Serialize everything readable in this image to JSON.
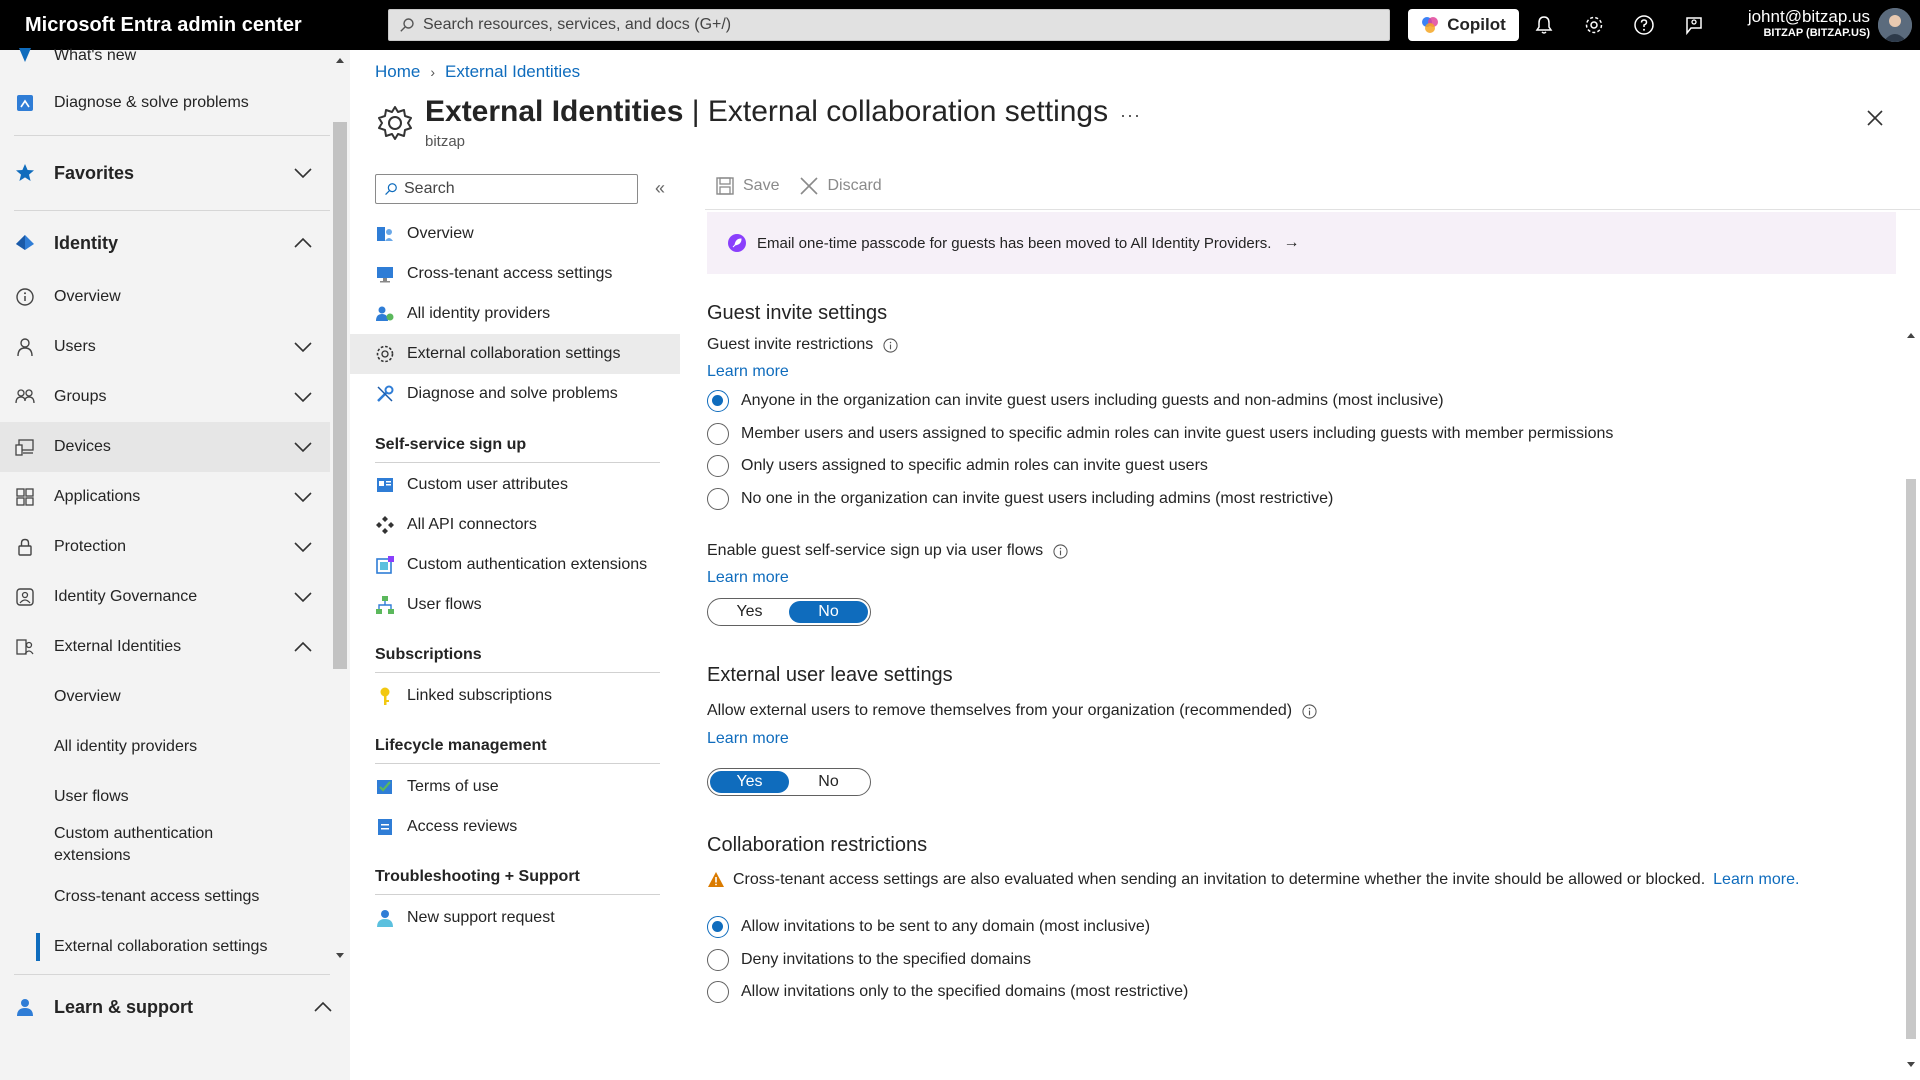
{
  "app": {
    "title": "Microsoft Entra admin center",
    "search_placeholder": "Search resources, services, and docs (G+/)",
    "copilot_label": "Copilot",
    "user_email": "johnt@bitzap.us",
    "user_tenant": "BITZAP (BITZAP.US)"
  },
  "leftnav": {
    "whats_new": "What's new",
    "diagnose": "Diagnose & solve problems",
    "favorites": "Favorites",
    "identity": "Identity",
    "overview": "Overview",
    "users": "Users",
    "groups": "Groups",
    "devices": "Devices",
    "applications": "Applications",
    "protection": "Protection",
    "identity_governance": "Identity Governance",
    "external_identities": "External Identities",
    "ext_overview": "Overview",
    "ext_all_providers": "All identity providers",
    "ext_user_flows": "User flows",
    "ext_custom_auth_line1": "Custom authentication",
    "ext_custom_auth_line2": "extensions",
    "ext_cross_tenant": "Cross-tenant access settings",
    "ext_collab": "External collaboration settings",
    "learn_support": "Learn & support"
  },
  "breadcrumb": {
    "home": "Home",
    "external": "External Identities"
  },
  "page": {
    "title_bold": "External Identities",
    "title_rest": " | External collaboration settings",
    "subtitle": "bitzap"
  },
  "resource_menu": {
    "search_placeholder": "Search",
    "overview": "Overview",
    "cross_tenant": "Cross-tenant access settings",
    "all_providers": "All identity providers",
    "collab_settings": "External collaboration settings",
    "diagnose": "Diagnose and solve problems",
    "group_self_service": "Self-service sign up",
    "custom_user_attributes": "Custom user attributes",
    "all_api_connectors": "All API connectors",
    "custom_auth_ext": "Custom authentication extensions",
    "user_flows": "User flows",
    "group_subscriptions": "Subscriptions",
    "linked_subscriptions": "Linked subscriptions",
    "group_lifecycle": "Lifecycle management",
    "terms_of_use": "Terms of use",
    "access_reviews": "Access reviews",
    "group_troubleshooting": "Troubleshooting + Support",
    "new_support_request": "New support request"
  },
  "toolbar": {
    "save": "Save",
    "discard": "Discard"
  },
  "banner": {
    "text": "Email one-time passcode for guests has been moved to All Identity Providers."
  },
  "guest_invite": {
    "title": "Guest invite settings",
    "restrictions_label": "Guest invite restrictions",
    "learn_more": "Learn more",
    "options": [
      "Anyone in the organization can invite guest users including guests and non-admins (most inclusive)",
      "Member users and users assigned to specific admin roles can invite guest users including guests with member permissions",
      "Only users assigned to specific admin roles can invite guest users",
      "No one in the organization can invite guest users including admins (most restrictive)"
    ],
    "selected_index": 0,
    "self_service_label": "Enable guest self-service sign up via user flows",
    "self_service_learn_more": "Learn more",
    "self_service_yes": "Yes",
    "self_service_no": "No",
    "self_service_value": "No"
  },
  "leave": {
    "title": "External user leave settings",
    "label": "Allow external users to remove themselves from your organization (recommended)",
    "learn_more": "Learn more",
    "yes": "Yes",
    "no": "No",
    "value": "Yes"
  },
  "collab": {
    "title": "Collaboration restrictions",
    "warning": "Cross-tenant access settings are also evaluated when sending an invitation to determine whether the invite should be allowed or blocked.",
    "warning_link": "Learn more.",
    "options": [
      "Allow invitations to be sent to any domain (most inclusive)",
      "Deny invitations to the specified domains",
      "Allow invitations only to the specified domains (most restrictive)"
    ],
    "selected_index": 0
  },
  "colors": {
    "accent": "#0f6cbd",
    "topbar": "#000000",
    "nav_bg": "#f3f3f3",
    "banner_bg": "#f6f0f8",
    "warning": "#da7b00"
  }
}
